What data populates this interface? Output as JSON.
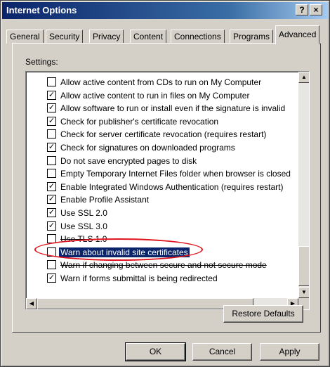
{
  "window": {
    "title": "Internet Options",
    "help": "?",
    "close": "×"
  },
  "tabs": [
    {
      "label": "General"
    },
    {
      "label": "Security"
    },
    {
      "label": "Privacy"
    },
    {
      "label": "Content"
    },
    {
      "label": "Connections"
    },
    {
      "label": "Programs"
    },
    {
      "label": "Advanced",
      "active": true
    }
  ],
  "settings_label": "Settings:",
  "settings": [
    {
      "label": "Allow active content from CDs to run on My Computer",
      "checked": false
    },
    {
      "label": "Allow active content to run in files on My Computer",
      "checked": true
    },
    {
      "label": "Allow software to run or install even if the signature is invalid",
      "checked": true
    },
    {
      "label": "Check for publisher's certificate revocation",
      "checked": true
    },
    {
      "label": "Check for server certificate revocation (requires restart)",
      "checked": false
    },
    {
      "label": "Check for signatures on downloaded programs",
      "checked": true
    },
    {
      "label": "Do not save encrypted pages to disk",
      "checked": false
    },
    {
      "label": "Empty Temporary Internet Files folder when browser is closed",
      "checked": false
    },
    {
      "label": "Enable Integrated Windows Authentication (requires restart)",
      "checked": true
    },
    {
      "label": "Enable Profile Assistant",
      "checked": true
    },
    {
      "label": "Use SSL 2.0",
      "checked": true
    },
    {
      "label": "Use SSL 3.0",
      "checked": true
    },
    {
      "label": "Use TLS 1.0",
      "checked": false,
      "struck": true
    },
    {
      "label": "Warn about invalid site certificates",
      "checked": false,
      "selected": true
    },
    {
      "label": "Warn if changing between secure and not secure mode",
      "checked": false,
      "struck": true
    },
    {
      "label": "Warn if forms submittal is being redirected",
      "checked": true
    }
  ],
  "icons": {
    "checkmark": "✓",
    "scroll_up": "▲",
    "scroll_down": "▼",
    "scroll_left": "◀",
    "scroll_right": "▶"
  },
  "buttons": {
    "restore_defaults": "Restore Defaults",
    "ok": "OK",
    "cancel": "Cancel",
    "apply": "Apply"
  },
  "colors": {
    "title_bar": "#0a246a",
    "selection": "#0a246a",
    "annotation_ellipse": "#e0141e"
  }
}
